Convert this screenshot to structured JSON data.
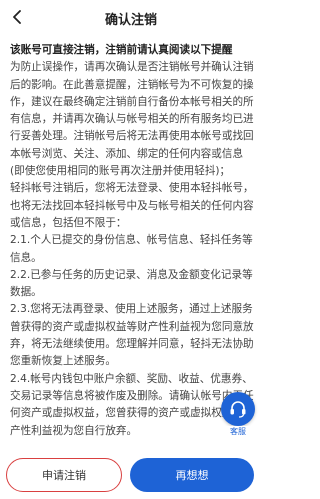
{
  "header": {
    "title": "确认注销",
    "back_icon": "back-arrow-icon"
  },
  "content": {
    "lead": "该账号可直接注销，注销前请认真阅读以下提醒",
    "para1": "为防止误操作，请再次确认是否注销帐号并确认注销后的影响。在此善意提醒，注销帐号为不可恢复的操作，建议在最终确定注销前自行备份本帐号相关的所有信息，并请再次确认与帐号相关的所有服务均已进行妥善处理。注销帐号后将无法再使用本帐号或找回本帐号浏览、关注、添加、绑定的任何内容或信息(即使您使用相同的账号再次注册并使用轻抖)；",
    "para2": "轻抖帐号注销后，您将无法登录、使用本轻抖帐号，也将无法找回本轻抖帐号中及与帐号相关的任何内容或信息，包括但不限于：",
    "item1": "2.1.个人已提交的身份信息、帐号信息、轻抖任务等信息。",
    "item2": "2.2.已参与任务的历史记录、消息及金额变化记录等数据。",
    "item3": "2.3.您将无法再登录、使用上述服务，通过上述服务曾获得的资产或虚拟权益等财产性利益视为您同意放弃，将无法继续使用。您理解并同意，轻抖无法协助您重新恢复上述服务。",
    "item4": "2.4.帐号内钱包中账户余额、奖励、收益、优惠券、交易记录等信息将被作废及删除。请确认帐号内无任何资产或虚拟权益，您曾获得的资产或虚拟权益等财产性利益视为您自行放弃。"
  },
  "support": {
    "label": "客服",
    "icon": "headset-icon"
  },
  "bottom": {
    "apply_label": "申请注销",
    "reconsider_label": "再想想"
  },
  "colors": {
    "accent": "#1e63d6",
    "apply_border": "#d94040"
  }
}
